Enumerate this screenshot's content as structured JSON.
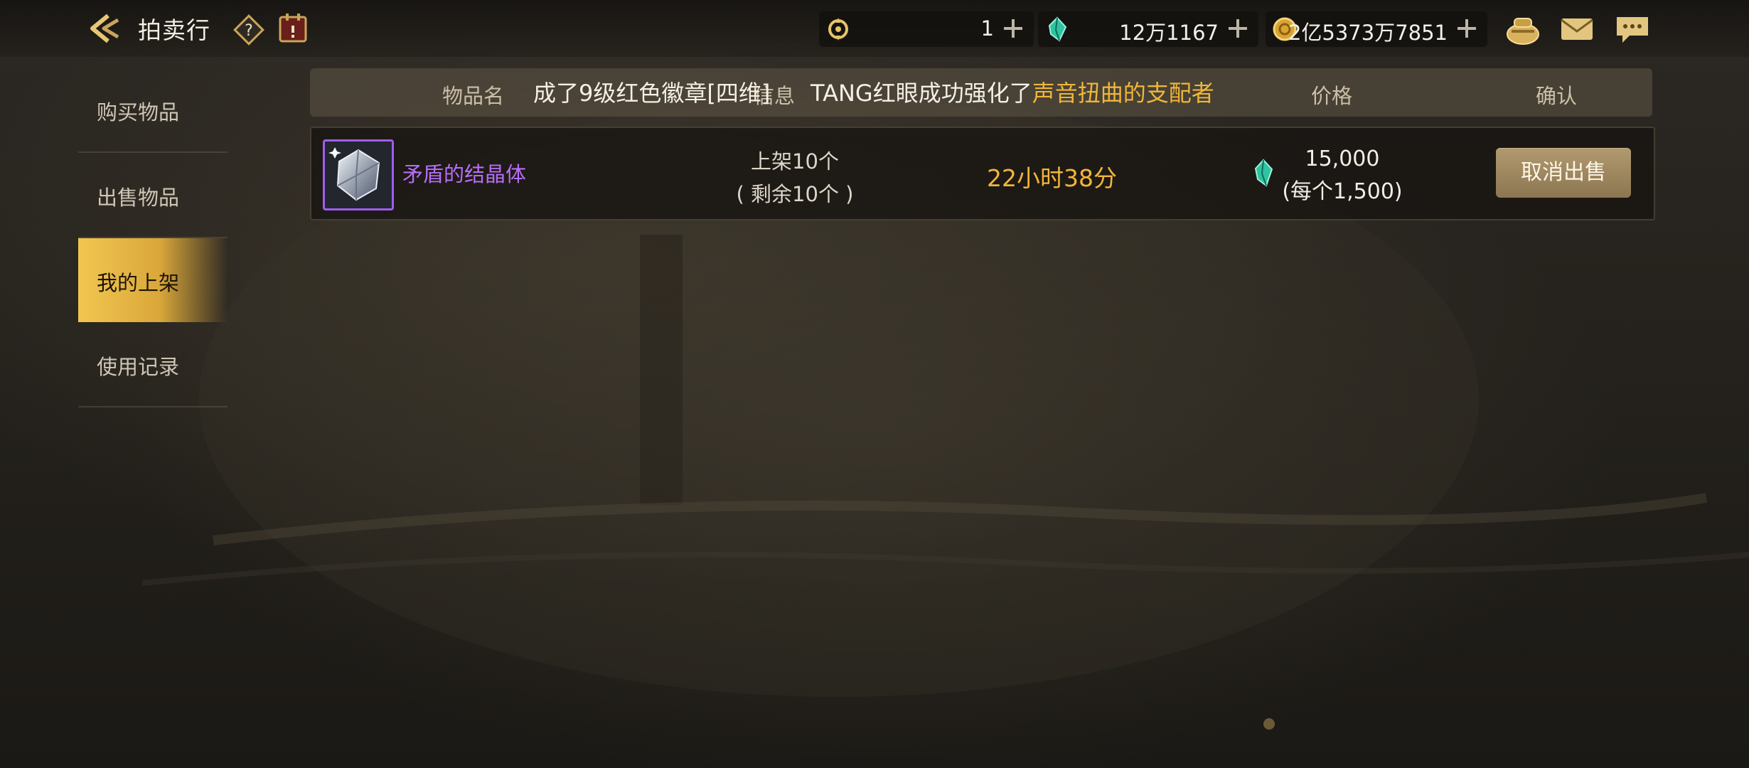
{
  "header": {
    "title": "拍卖行",
    "icons": [
      "back-arrow-icon",
      "help-icon",
      "calendar-icon"
    ]
  },
  "currencies": [
    {
      "icon": "season-coin-icon",
      "value": "1"
    },
    {
      "icon": "green-gem-icon",
      "value": "12万1167"
    },
    {
      "icon": "gold-coin-icon",
      "value": "2亿5373万7851"
    }
  ],
  "top_icons": [
    "pouch-icon",
    "mail-icon",
    "chat-icon"
  ],
  "sidebar": {
    "items": [
      {
        "label": "购买物品"
      },
      {
        "label": "出售物品"
      },
      {
        "label": "我的上架"
      },
      {
        "label": "使用记录"
      }
    ],
    "active_index": 2
  },
  "table": {
    "columns": {
      "name": "物品名",
      "info": "信息",
      "price": "价格",
      "confirm": "确认"
    },
    "marquee": {
      "prefix": "成了9级红色徽章[四维]",
      "middle": "TANG红眼成功强化了",
      "highlight": "声音扭曲的支配者"
    },
    "rows": [
      {
        "name": "矛盾的结晶体",
        "listed": "上架10个",
        "remaining": "( 剩余10个 )",
        "time_left": "22小时38分",
        "price_total": "15,000",
        "price_each": "(每个1,500)",
        "action": "取消出售"
      }
    ]
  },
  "colors": {
    "accent_gold": "#f1b63b",
    "item_purple": "#b76ef8",
    "active_tab": "#f2c651"
  }
}
